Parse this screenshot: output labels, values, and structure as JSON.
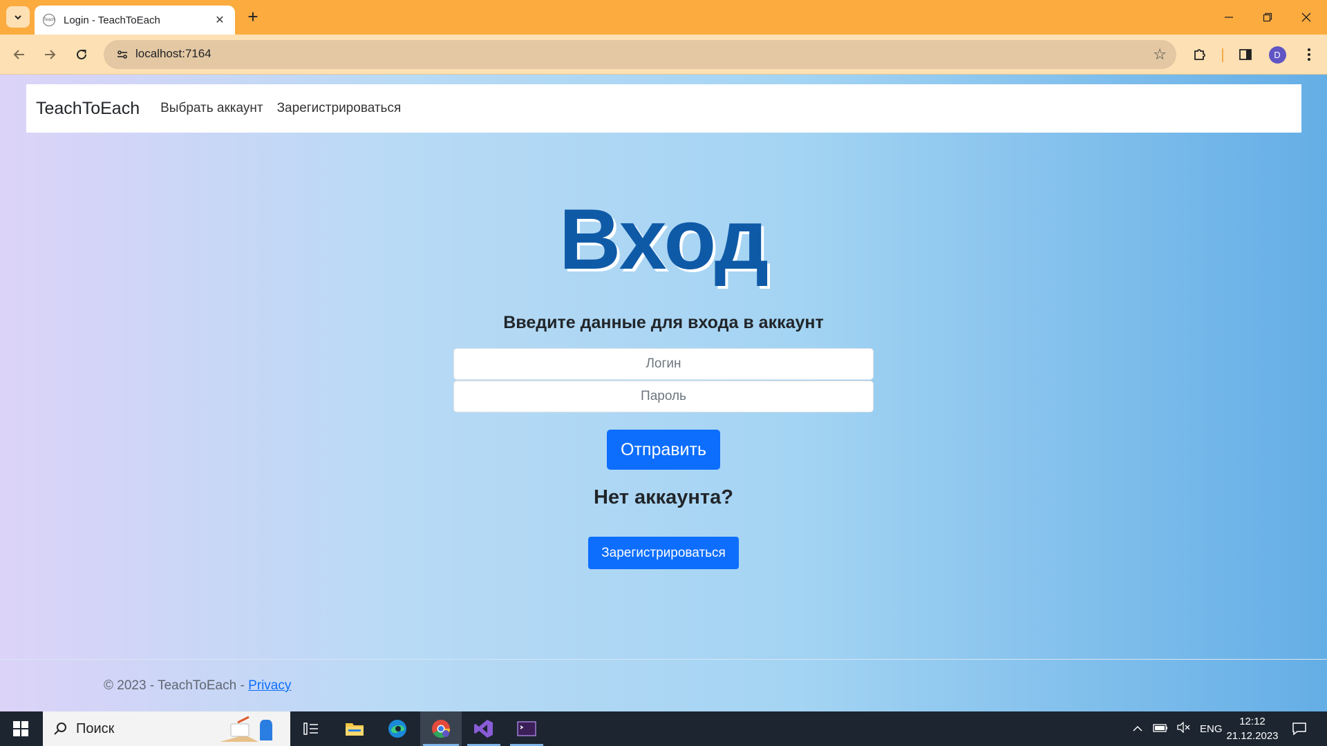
{
  "browser": {
    "tab_title": "Login - TeachToEach",
    "favicon_text": "Teach",
    "new_tab_label": "+",
    "url": "localhost:7164",
    "profile_initial": "D"
  },
  "navbar": {
    "brand": "TeachToEach",
    "links": [
      "Выбрать аккаунт",
      "Зарегистрироваться"
    ]
  },
  "login": {
    "heading": "Вход",
    "subtitle": "Введите данные для входа в аккаунт",
    "login_placeholder": "Логин",
    "password_placeholder": "Пароль",
    "submit_label": "Отправить",
    "no_account_text": "Нет аккаунта?",
    "register_label": "Зарегистрироваться"
  },
  "footer": {
    "copyright": "© 2023 - TeachToEach -",
    "privacy_link": "Privacy"
  },
  "taskbar": {
    "search_placeholder": "Поиск",
    "language": "ENG",
    "time": "12:12",
    "date": "21.12.2023"
  },
  "colors": {
    "titlebar": "#fcab3f",
    "toolbar": "#fde0b3",
    "primary_button": "#0d6efd",
    "heading": "#0f5aa7"
  }
}
